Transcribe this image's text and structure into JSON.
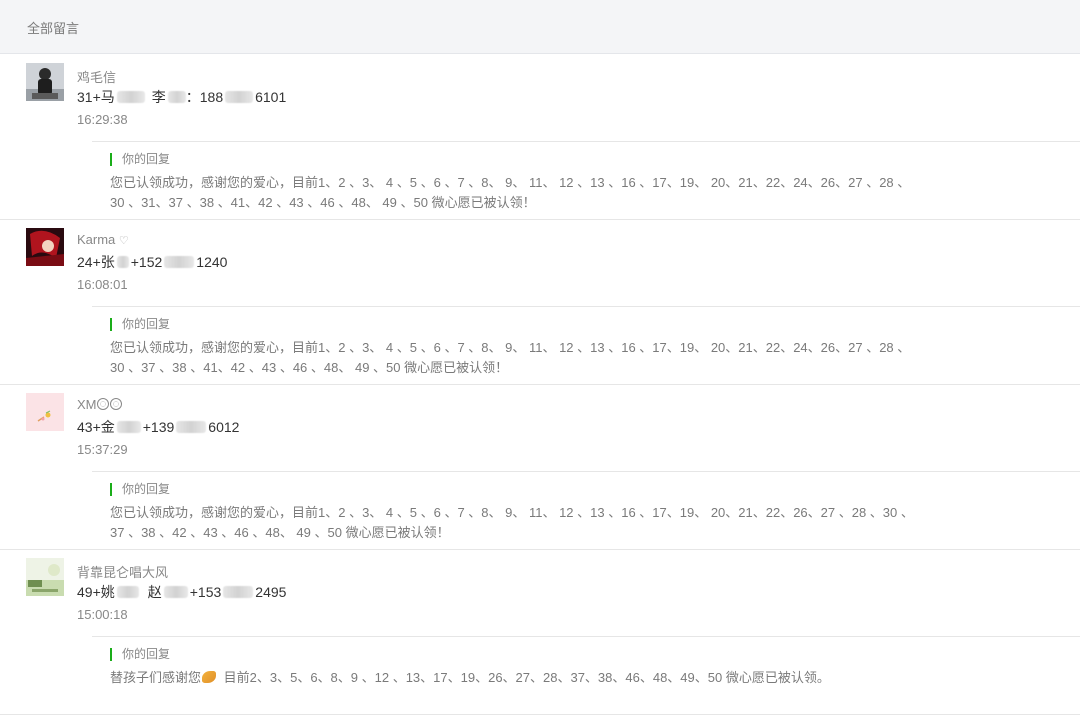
{
  "header": {
    "title": "全部留言"
  },
  "reply_label": "你的回复",
  "comments": [
    {
      "nickname": "鸡毛信",
      "content": [
        "31+马",
        "李",
        "：188",
        "6101"
      ],
      "time": "16:29:38",
      "reply": "您已认领成功，感谢您的爱心，目前1、2 、3、 4 、5 、6 、7 、8、 9、 11、 12 、13 、16 、17、19、 20、21、22、24、26、27 、28 、30 、31、37 、38 、41、42 、43 、46 、48、 49 、50 微心愿已被认领！"
    },
    {
      "nickname": "Karma",
      "content": [
        "24+张",
        "+152",
        "1240"
      ],
      "time": "16:08:01",
      "reply": "您已认领成功，感谢您的爱心，目前1、2 、3、 4 、5 、6 、7 、8、 9、 11、 12 、13 、16 、17、19、 20、21、22、24、26、27 、28 、30 、37 、38 、41、42 、43 、46 、48、 49 、50 微心愿已被认领！"
    },
    {
      "nickname": "XM",
      "content": [
        "43+金",
        "+139",
        "6012"
      ],
      "time": "15:37:29",
      "reply": "您已认领成功，感谢您的爱心，目前1、2 、3、 4 、5 、6 、7 、8、 9、 11、 12 、13 、16 、17、19、 20、21、22、26、27 、28 、30 、37 、38 、42 、43 、46 、48、 49 、50 微心愿已被认领！"
    },
    {
      "nickname": "背靠昆仑唱大风",
      "content": [
        "49+姚",
        "赵",
        "+153",
        "2495"
      ],
      "time": "15:00:18",
      "reply_a": "替孩子们感谢您",
      "reply_b": "目前2、3、5、6、8、9 、12 、13、17、19、26、27、28、37、38、46、48、49、50 微心愿已被认领。"
    }
  ],
  "icons": {
    "c2_badge": "heart-icon",
    "c3_badge": "emoji-icon",
    "c4_reply": "praying-hands-icon"
  },
  "colors": {
    "accent": "#1aad19",
    "header_bg": "#f4f5f7",
    "text": "#333333",
    "muted": "#888888"
  }
}
